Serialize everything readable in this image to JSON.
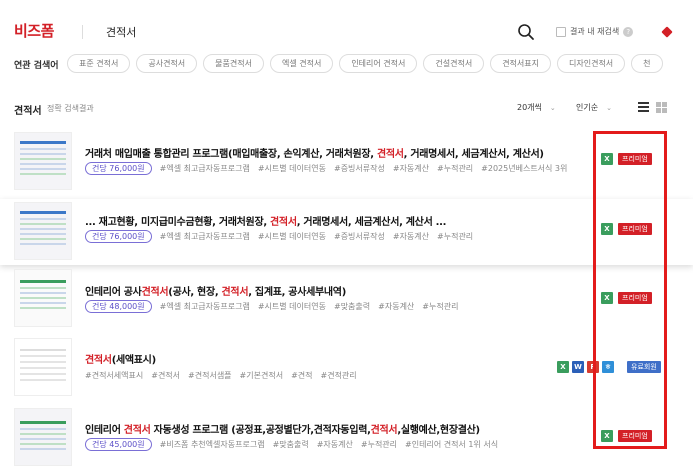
{
  "header": {
    "logo": "비즈폼",
    "title": "견적서",
    "search_within_label": "결과 내 재검색",
    "help_glyph": "?"
  },
  "related": {
    "label": "연관 검색어",
    "chips": [
      "표준 견적서",
      "공사견적서",
      "물품견적서",
      "엑셀 견적서",
      "인테리어 견적서",
      "건설견적서",
      "견적서표지",
      "디자인견적서",
      "천"
    ]
  },
  "results": {
    "title": "견적서",
    "subtitle": "정확 검색결과",
    "count_option": "20개씩",
    "order_option": "인기순"
  },
  "items": [
    {
      "title_parts": [
        "거래처 매입매출 통합관리 프로그램(매입매출장, 손익계산, 거래처원장, ",
        "견적서",
        ", 거래명세서, 세금계산서, 계산서)"
      ],
      "price": "건당 76,000원",
      "tags": [
        "#엑셀 최고급자동프로그램",
        "#시트별 데이터연동",
        "#증빙서류작성",
        "#자동계산",
        "#누적관리",
        "#2025년베스트서식 3위"
      ],
      "badge": "프리미엄"
    },
    {
      "title_parts": [
        "... 재고현황, 미지급미수금현황, 거래처원장, ",
        "견적서",
        ", 거래명세서, 세금계산서, 계산서 ..."
      ],
      "price": "건당 76,000원",
      "tags": [
        "#엑셀 최고급자동프로그램",
        "#시트별 데이터연동",
        "#증빙서류작성",
        "#자동계산",
        "#누적관리"
      ],
      "badge": "프리미엄"
    },
    {
      "title_parts": [
        "인테리어 공사",
        "견적서",
        "(공사, 현장, ",
        "견적서",
        ", 집계표, 공사세부내역)"
      ],
      "price": "건당 48,000원",
      "tags": [
        "#엑셀 최고급자동프로그램",
        "#시트별 데이터연동",
        "#맞춤출력",
        "#자동계산",
        "#누적관리"
      ],
      "badge": "프리미엄"
    },
    {
      "title_parts": [
        "",
        "견적서",
        "(세액표시)"
      ],
      "tags": [
        "#견적서세액표시",
        "#견적서",
        "#견적서샘플",
        "#기본견적서",
        "#견적",
        "#견적관리"
      ],
      "badge": "유료회원"
    },
    {
      "title_parts": [
        "인테리어 ",
        "견적서",
        " 자동생성 프로그램 (공정표,공정별단가,견적자동입력,",
        "견적서",
        ",실행예산,현장결산)"
      ],
      "price": "건당 45,000원",
      "tags": [
        "#비즈폼 추천엑셀자동프로그램",
        "#맞춤출력",
        "#자동계산",
        "#누적관리",
        "#인테리어 견적서 1위 서식"
      ],
      "badge": "프리미엄"
    }
  ],
  "file_icons": {
    "excel": "X",
    "word": "W",
    "pdf": "P",
    "hwp": "ㅎ"
  },
  "colors": {
    "brand": "#d32027",
    "price_border": "#7a6fd6",
    "excel": "#3a9d5d",
    "free": "#3f6fc8",
    "highlight_box": "#e31b1b"
  }
}
